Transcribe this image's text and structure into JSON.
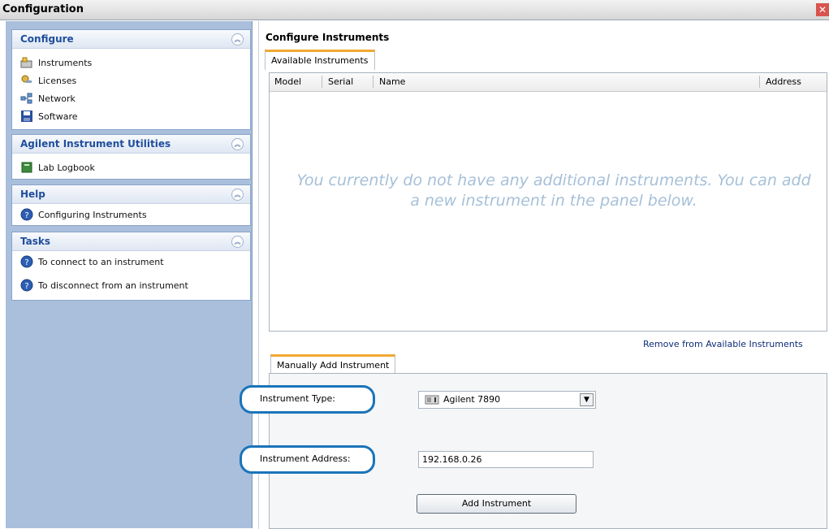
{
  "window": {
    "title": "Configuration"
  },
  "sidebar": {
    "configure": {
      "title": "Configure",
      "items": [
        {
          "label": "Instruments",
          "icon": "instruments-icon"
        },
        {
          "label": "Licenses",
          "icon": "licenses-icon"
        },
        {
          "label": "Network",
          "icon": "network-icon"
        },
        {
          "label": "Software",
          "icon": "software-icon"
        }
      ]
    },
    "utilities": {
      "title": "Agilent Instrument Utilities",
      "items": [
        {
          "label": "Lab Logbook",
          "icon": "logbook-icon"
        }
      ]
    },
    "help": {
      "title": "Help",
      "items": [
        {
          "label": "Configuring Instruments",
          "icon": "help-icon"
        }
      ]
    },
    "tasks": {
      "title": "Tasks",
      "items": [
        {
          "label": "To connect to an instrument",
          "icon": "help-icon"
        },
        {
          "label": "To disconnect from an instrument",
          "icon": "help-icon"
        }
      ]
    }
  },
  "main": {
    "title": "Configure Instruments",
    "tab_available": "Available Instruments",
    "columns": [
      "Model",
      "Serial",
      "Name",
      "Address"
    ],
    "empty_message": "You currently do not have any additional instruments.  You can add a new instrument in the panel below.",
    "remove_link": "Remove from Available Instruments",
    "tab_manual": "Manually Add Instrument",
    "instrument_type_label": "Instrument Type:",
    "instrument_type_value": "Agilent 7890",
    "instrument_address_label": "Instrument Address:",
    "instrument_address_value": "192.168.0.26",
    "add_button": "Add Instrument"
  },
  "colors": {
    "sidebar_bg": "#a9bfdc",
    "header_text": "#1f4e9c",
    "highlight_ring": "#1b74b9",
    "tab_accent": "#f0a833"
  }
}
